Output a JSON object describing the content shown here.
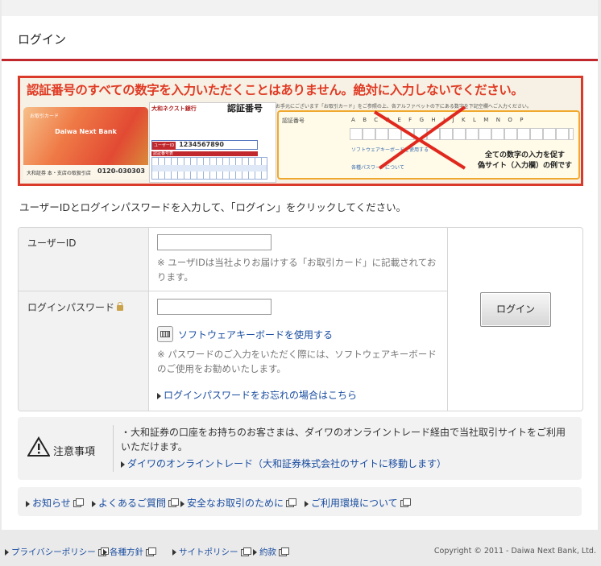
{
  "page": {
    "title": "ログイン"
  },
  "banner": {
    "headline": "認証番号のすべての数字を入力いただくことはありません。絶対に入力しないでください。",
    "card_title": "お取引カード",
    "card_brand": "Daiwa Next Bank",
    "card_bank": "大和証券 本・支店の取扱引店",
    "card_phone": "0120-030303",
    "sheet_bank": "大和ネクスト銀行",
    "sheet_label": "認証番号",
    "sheet_userid_tag": "ユーザーID",
    "sheet_userid": "1234567890",
    "sheet_grid_label": "認証番号表",
    "form_text": "お手元にございます「お取引カード」をご参照の上、各アルファベットの下にある数字を下記空欄へご入力ください。",
    "form_label": "認証番号",
    "form_letters": "ABCDEFGHIJKLMNOP",
    "form_kbd_link": "ソフトウェアキーボードを使用する",
    "form_forgot_link": "各種パスワードについて",
    "note_line1": "全ての数字の入力を促す",
    "note_line2": "偽サイト（入力欄）の例です"
  },
  "instructions": "ユーザーIDとログインパスワードを入力して、「ログイン」をクリックしてください。",
  "login": {
    "userid_label": "ユーザーID",
    "userid_value": "",
    "userid_note": "※ ユーザIDは当社よりお届けする「お取引カード」に記載されております。",
    "password_label": "ログインパスワード",
    "password_value": "",
    "keyboard_link": "ソフトウェアキーボードを使用する",
    "password_note": "※ パスワードのご入力をいただく際には、ソフトウェアキーボードのご使用をお勧めいたします。",
    "forgot_link": "ログインパスワードをお忘れの場合はこちら",
    "login_button": "ログイン"
  },
  "notice": {
    "label": "注意事項",
    "text": "・大和証券の口座をお持ちのお客さまは、ダイワのオンライントレード経由で当社取引サイトをご利用いただけます。",
    "link": "ダイワのオンライントレード（大和証券株式会社のサイトに移動します）"
  },
  "links": [
    {
      "label": "お知らせ"
    },
    {
      "label": "よくあるご質問"
    },
    {
      "label": "安全なお取引のために"
    },
    {
      "label": "ご利用環境について"
    }
  ],
  "footer": {
    "links": [
      {
        "label": "プライバシーポリシー"
      },
      {
        "label": "各種方針"
      },
      {
        "label": "サイトポリシー"
      },
      {
        "label": "約款"
      }
    ],
    "copyright": "Copyright © 2011 - Daiwa Next Bank, Ltd."
  },
  "colors": {
    "accent_red": "#c0282d",
    "link_blue": "#1a4da0",
    "warning_red": "#e03a24"
  }
}
